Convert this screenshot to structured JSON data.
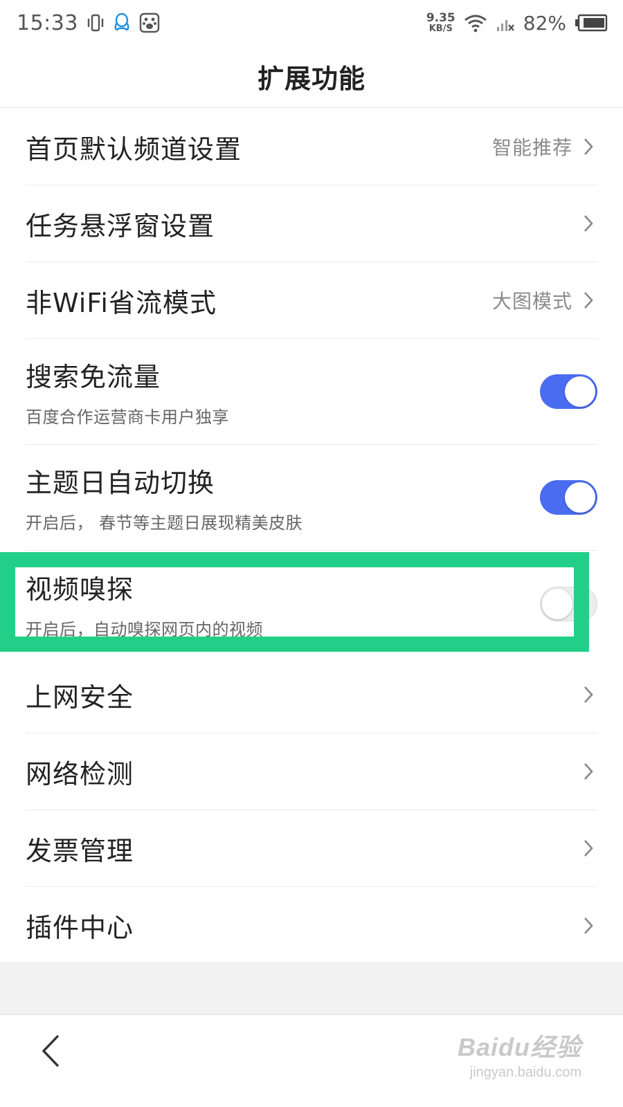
{
  "status_bar": {
    "time": "15:33",
    "speed_value": "9.35",
    "speed_unit": "KB/S",
    "battery_percent": "82%",
    "icons": [
      "vibrate-icon",
      "qq-icon",
      "baidu-paw-icon",
      "wifi-icon",
      "signal-icon",
      "battery-icon"
    ]
  },
  "header": {
    "title": "扩展功能"
  },
  "settings": {
    "items": [
      {
        "label": "首页默认频道设置",
        "value": "智能推荐"
      },
      {
        "label": "任务悬浮窗设置"
      },
      {
        "label": "非WiFi省流模式",
        "value": "大图模式"
      },
      {
        "label": "搜索免流量",
        "sub": "百度合作运营商卡用户独享",
        "toggle": "on"
      },
      {
        "label": "主题日自动切换",
        "sub": "开启后， 春节等主题日展现精美皮肤",
        "toggle": "on"
      },
      {
        "label": "视频嗅探",
        "sub": "开启后，自动嗅探网页内的视频",
        "toggle": "off"
      },
      {
        "label": "上网安全"
      },
      {
        "label": "网络检测"
      },
      {
        "label": "发票管理"
      },
      {
        "label": "插件中心"
      }
    ]
  },
  "highlight": {
    "color": "#21cf88",
    "target": "视频嗅探"
  },
  "colors": {
    "accent": "#4a6cf0",
    "toggle_off": "#ececec",
    "highlight": "#21cf88"
  },
  "watermark": {
    "main": "Baidu经验",
    "sub": "jingyan.baidu.com"
  }
}
